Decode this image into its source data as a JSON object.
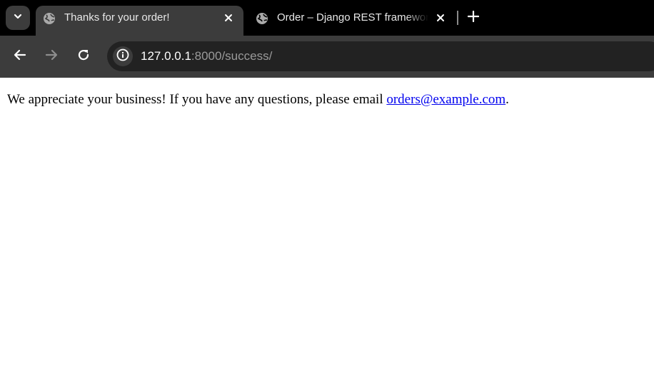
{
  "browser": {
    "tabs": [
      {
        "title": "Thanks for your order!",
        "active": true
      },
      {
        "title": "Order – Django REST framework",
        "active": false
      }
    ],
    "address_bar": {
      "host": "127.0.0.1",
      "path": ":8000/success/"
    }
  },
  "page": {
    "message": "We appreciate your business! If you have any questions, please email ",
    "email_link": "orders@example.com",
    "message_end": "."
  },
  "colors": {
    "tabstrip": "#000000",
    "toolbar": "#3c3c3c",
    "omnibox": "#222222",
    "link": "#0000ee"
  },
  "icons": [
    "tab-search-icon",
    "globe-icon",
    "close-icon",
    "plus-icon",
    "back-arrow-icon",
    "forward-arrow-icon",
    "reload-icon",
    "info-icon"
  ]
}
